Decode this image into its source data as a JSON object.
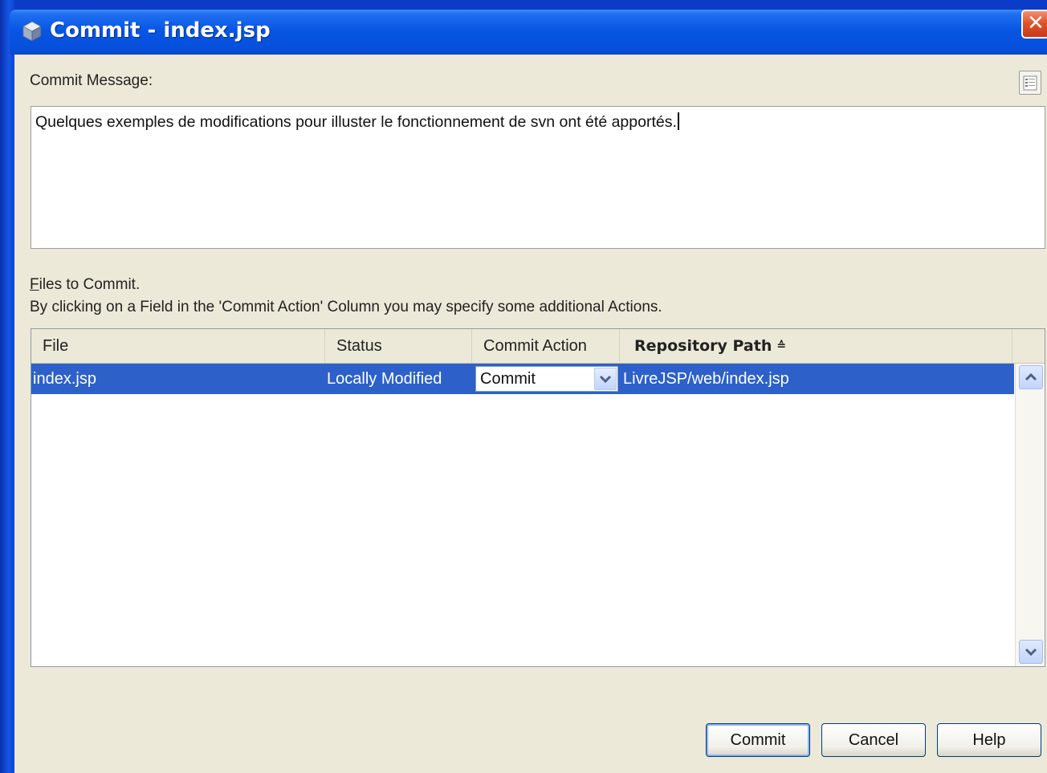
{
  "window": {
    "title": "Commit - index.jsp",
    "close_symbol": "✕"
  },
  "commit_message": {
    "label": "Commit Message:",
    "value": "Quelques exemples de modifications pour illuster le fonctionnement de svn ont été apportés."
  },
  "files": {
    "label_mnemonic": "F",
    "label_rest": "iles to Commit.",
    "hint": "By clicking on a Field in the 'Commit Action' Column you may specify some additional Actions."
  },
  "table": {
    "columns": [
      "File",
      "Status",
      "Commit Action",
      "Repository Path"
    ],
    "sort_indicator": "≙",
    "rows": [
      {
        "file": "index.jsp",
        "status": "Locally Modified",
        "commit_action": "Commit",
        "repository_path": "LivreJSP/web/index.jsp"
      }
    ]
  },
  "buttons": {
    "commit": "Commit",
    "cancel": "Cancel",
    "help": "Help"
  },
  "colors": {
    "titlebar": "#0650dc",
    "dialog_bg": "#ece9d8",
    "selection": "#2d61c9"
  },
  "icons": {
    "title": "netbeans-cube-icon",
    "template": "message-template-icon",
    "combo": "chevron-down-icon",
    "scroll_up": "chevron-up-icon",
    "scroll_down": "chevron-down-icon"
  }
}
